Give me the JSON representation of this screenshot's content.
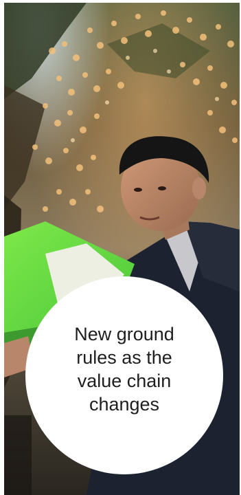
{
  "hero": {
    "headline": "New ground rules as the value chain changes"
  }
}
